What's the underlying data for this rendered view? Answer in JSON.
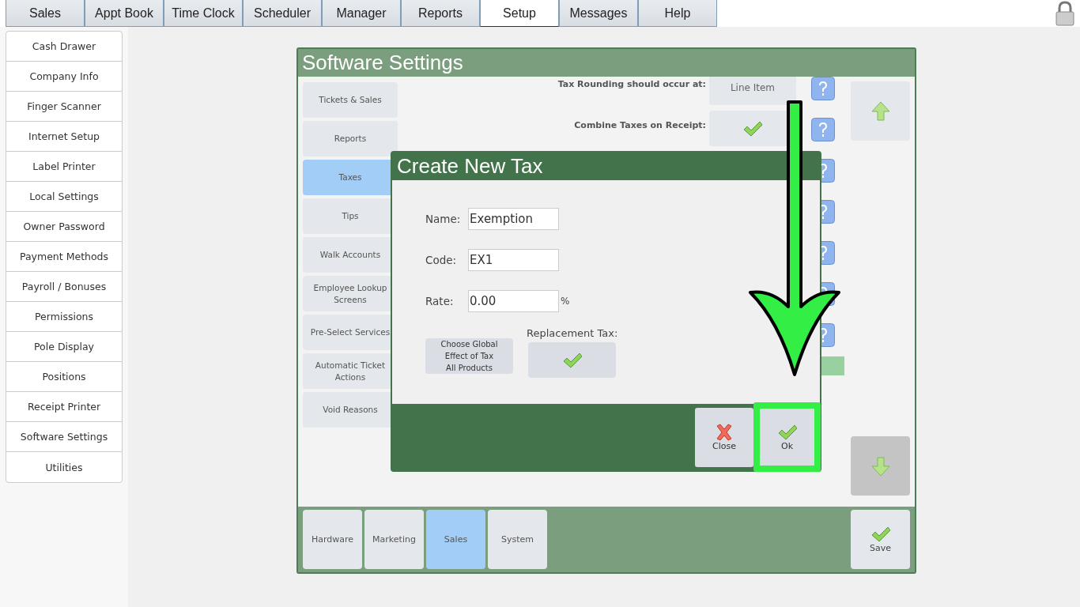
{
  "top_tabs": [
    {
      "label": "Sales",
      "selected": false
    },
    {
      "label": "Appt Book",
      "selected": false
    },
    {
      "label": "Time Clock",
      "selected": false
    },
    {
      "label": "Scheduler",
      "selected": false
    },
    {
      "label": "Manager",
      "selected": false
    },
    {
      "label": "Reports",
      "selected": false
    },
    {
      "label": "Setup",
      "selected": true
    },
    {
      "label": "Messages",
      "selected": false
    },
    {
      "label": "Help",
      "selected": false
    }
  ],
  "sidebar": {
    "items": [
      "Cash Drawer",
      "Company Info",
      "Finger Scanner",
      "Internet Setup",
      "Label Printer",
      "Local Settings",
      "Owner Password",
      "Payment Methods",
      "Payroll / Bonuses",
      "Permissions",
      "Pole Display",
      "Positions",
      "Receipt Printer",
      "Software Settings",
      "Utilities"
    ]
  },
  "panel": {
    "title": "Software Settings",
    "categories": [
      {
        "label": "Tickets & Sales",
        "selected": false
      },
      {
        "label": "Reports",
        "selected": false
      },
      {
        "label": "Taxes",
        "selected": true
      },
      {
        "label": "Tips",
        "selected": false
      },
      {
        "label": "Walk Accounts",
        "selected": false
      },
      {
        "label": "Employee Lookup Screens",
        "selected": false
      },
      {
        "label": "Pre-Select Services",
        "selected": false
      },
      {
        "label": "Automatic Ticket Actions",
        "selected": false
      },
      {
        "label": "Void Reasons",
        "selected": false
      }
    ],
    "settings": [
      {
        "label": "Tax Rounding should occur at:",
        "kind": "text",
        "value": "Line Item"
      },
      {
        "label": "Combine Taxes on Receipt:",
        "kind": "check",
        "checked": true
      }
    ],
    "scroll_buttons": [
      {
        "kind": "up",
        "pressed": false
      },
      {
        "kind": "down",
        "pressed": true
      }
    ],
    "bottom_tabs": [
      {
        "label": "Hardware",
        "selected": false
      },
      {
        "label": "Marketing",
        "selected": false
      },
      {
        "label": "Sales",
        "selected": true
      },
      {
        "label": "System",
        "selected": false
      }
    ],
    "save": "Save"
  },
  "dialog": {
    "title": "Create New Tax",
    "fields": [
      {
        "label": "Name:",
        "value": "Exemption"
      },
      {
        "label": "Code:",
        "value": "EX1"
      },
      {
        "label": "Rate:",
        "value": "0.00",
        "suffix": "%"
      }
    ],
    "global_button": "Choose Global\nEffect of Tax\nAll Products",
    "replacement": {
      "label": "Replacement Tax:",
      "checked": true
    },
    "buttons": [
      {
        "label": "Close",
        "kind": "close",
        "highlighted": false
      },
      {
        "label": "Ok",
        "kind": "ok",
        "highlighted": true
      }
    ]
  }
}
